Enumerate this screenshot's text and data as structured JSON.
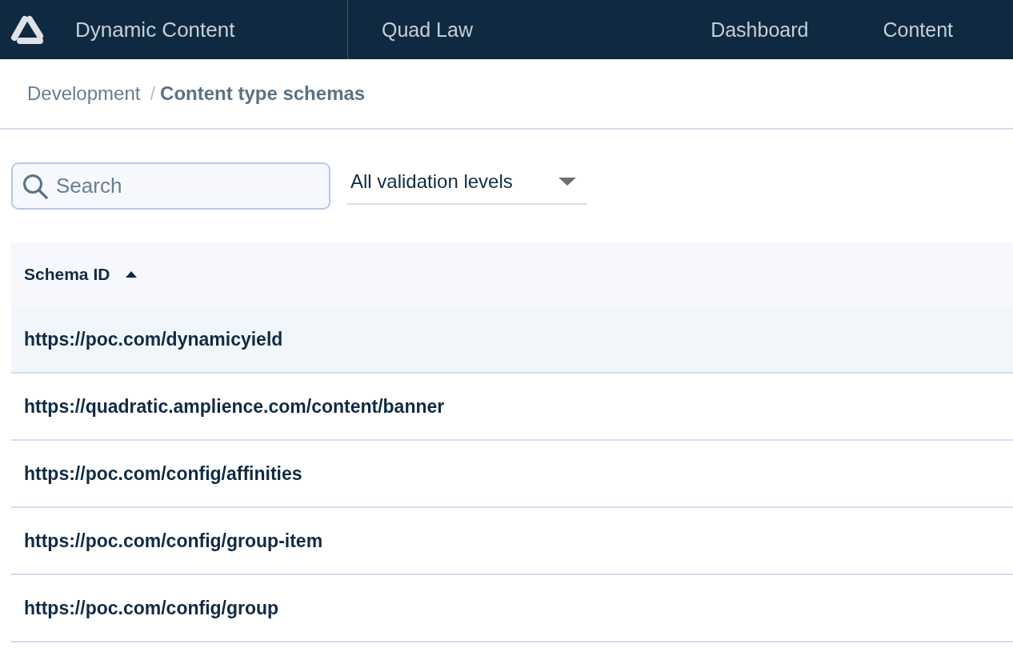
{
  "top_bar": {
    "app_name": "Dynamic Content",
    "hub_name": "Quad Law",
    "nav_items": [
      {
        "label": "Dashboard",
        "selected": false
      },
      {
        "label": "Content",
        "selected": false
      }
    ]
  },
  "breadcrumb": {
    "separator": "/",
    "items": [
      {
        "label": "Development",
        "current": false
      },
      {
        "label": "Content type schemas",
        "current": true
      }
    ]
  },
  "filters": {
    "search": {
      "placeholder": "Search"
    },
    "validation_dropdown": {
      "value": "All validation levels"
    }
  },
  "table": {
    "columns": [
      {
        "label": "Schema ID",
        "sort_ascending": true
      }
    ],
    "rows": [
      {
        "schema_id": "https://poc.com/dynamicyield",
        "selected": true
      },
      {
        "schema_id": "https://quadratic.amplience.com/content/banner",
        "selected": false
      },
      {
        "schema_id": "https://poc.com/config/affinities",
        "selected": false
      },
      {
        "schema_id": "https://poc.com/config/group-item",
        "selected": false
      },
      {
        "schema_id": "https://poc.com/config/group",
        "selected": false
      }
    ]
  }
}
